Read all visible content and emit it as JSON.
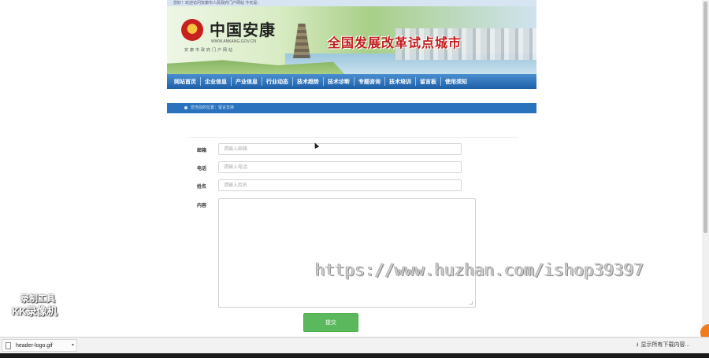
{
  "top_strip": {
    "text": "您好！欢迎访问安康市人民政府门户网站 今天是："
  },
  "banner": {
    "logo_text": "中国安康",
    "logo_url": "WWW.ANKANG.GOV.CN",
    "logo_sub": "安康市政府门户网站",
    "slogan": "全国发展改革试点城市"
  },
  "nav": {
    "items": [
      {
        "label": "网站首页"
      },
      {
        "label": "企业信息"
      },
      {
        "label": "产业信息"
      },
      {
        "label": "行业动态"
      },
      {
        "label": "技术趋势"
      },
      {
        "label": "技术诊断"
      },
      {
        "label": "专题咨询"
      },
      {
        "label": "技术培训"
      },
      {
        "label": "留言板"
      },
      {
        "label": "使用须知"
      }
    ]
  },
  "breadcrumb": {
    "text": "您当前的位置：留言支持"
  },
  "form": {
    "email_label": "邮箱",
    "email_placeholder": "请输入邮箱",
    "phone_label": "电话",
    "phone_placeholder": "请输入电话",
    "name_label": "姓名",
    "name_placeholder": "请输入姓名",
    "content_label": "内容",
    "submit_label": "提交"
  },
  "watermark": {
    "url": "https://www.huzhan.com/ishop39397",
    "left_line1": "录制工具",
    "left_line2": "KK录像机"
  },
  "download_bar": {
    "file_name": "header-logo.gif",
    "show_all": "显示所有下载内容..."
  }
}
